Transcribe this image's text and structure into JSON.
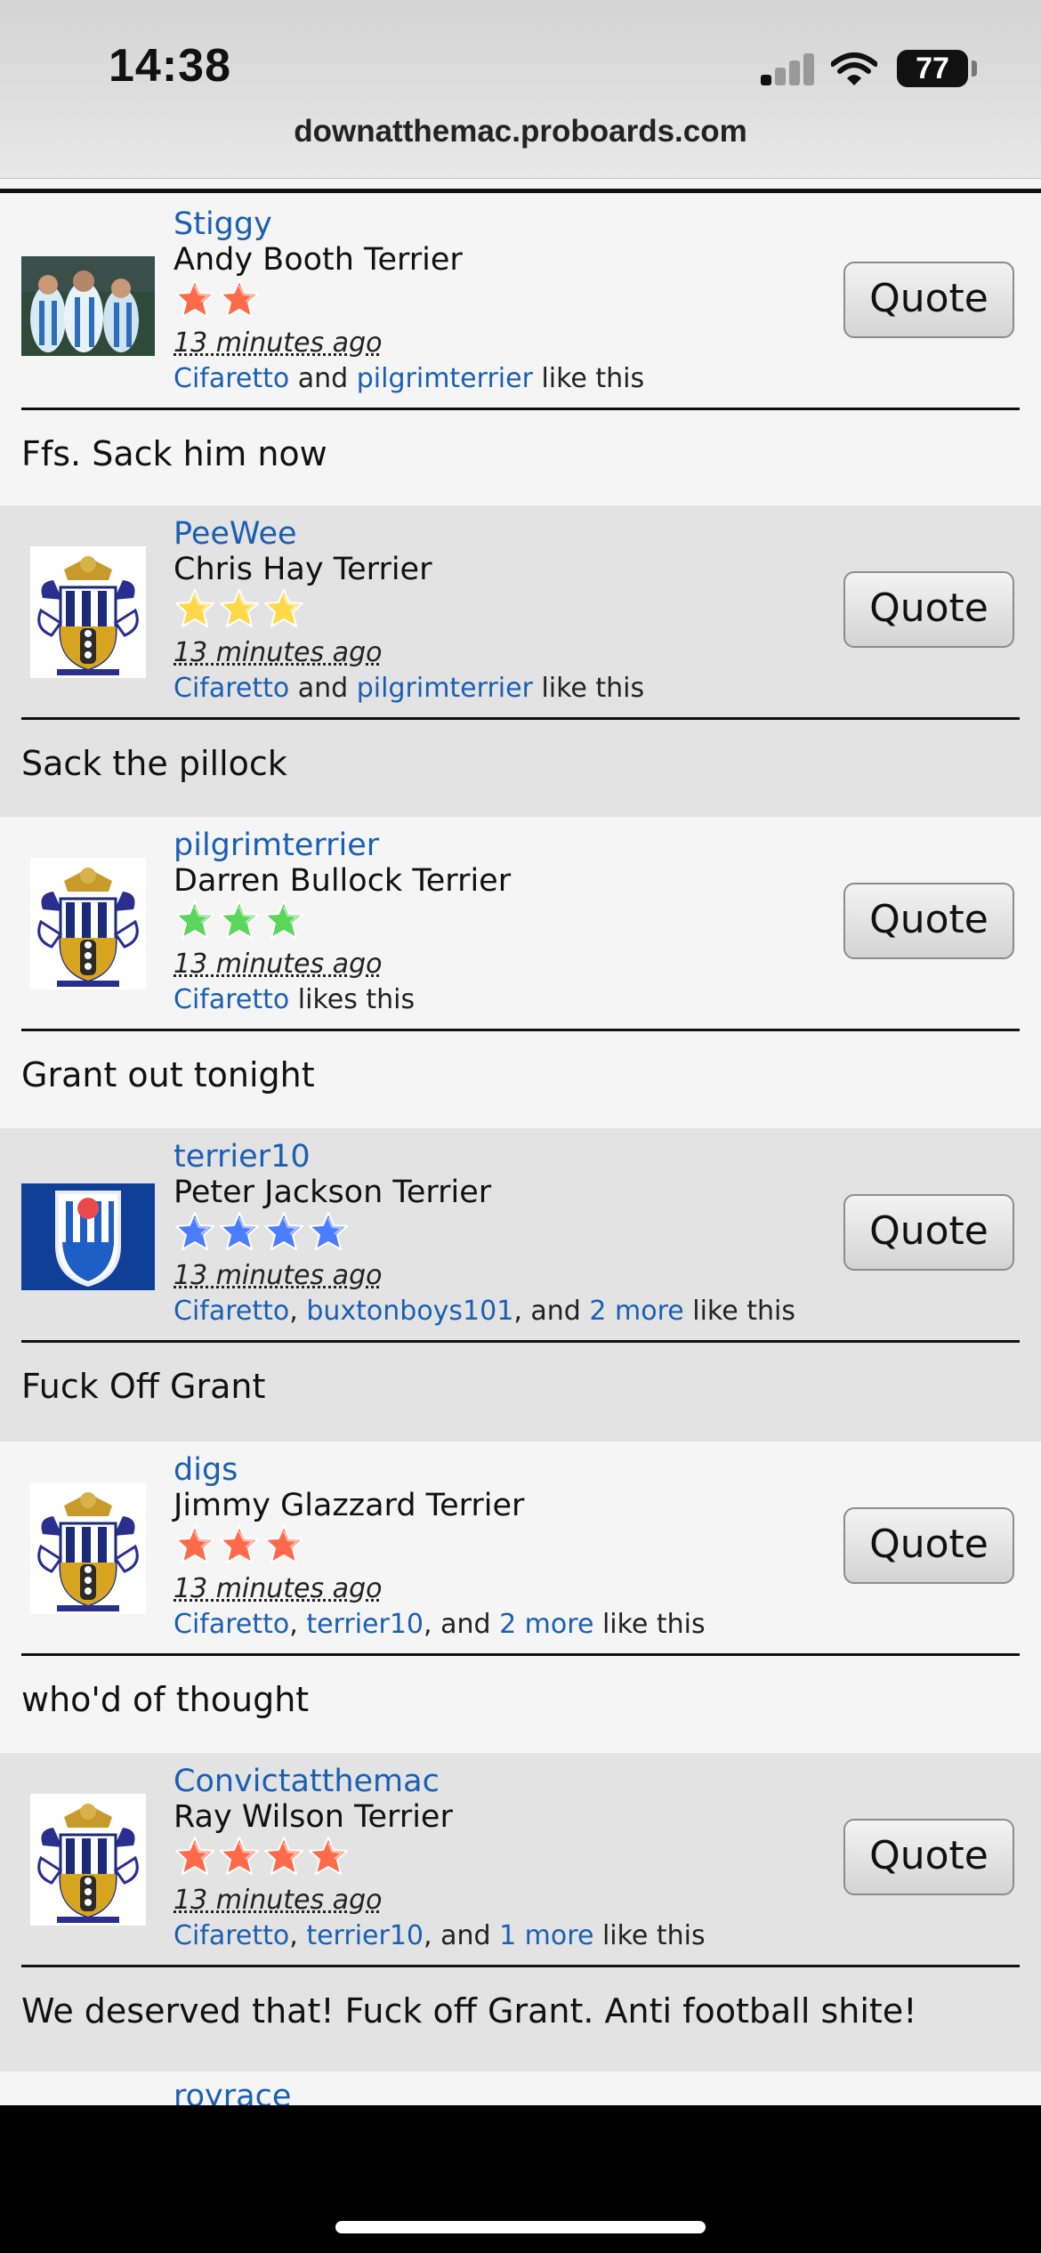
{
  "status": {
    "time": "14:38",
    "battery": "77"
  },
  "browser": {
    "url": "downatthemac.proboards.com"
  },
  "posts": [
    {
      "username": "Stiggy",
      "rank": "Andy Booth Terrier",
      "stars": 2,
      "star_color": "#ff6b4a",
      "time_ago": "13 minutes ago",
      "likes": {
        "user1": "Cifaretto",
        "sep1": " and ",
        "user2": "pilgrimterrier",
        "more": "",
        "suffix": " like this"
      },
      "quote_label": "Quote",
      "message": "Ffs. Sack him now"
    },
    {
      "username": "PeeWee",
      "rank": "Chris Hay Terrier",
      "stars": 3,
      "star_color": "#ffd84a",
      "time_ago": "13 minutes ago",
      "likes": {
        "user1": "Cifaretto",
        "sep1": " and ",
        "user2": "pilgrimterrier",
        "more": "",
        "suffix": " like this"
      },
      "quote_label": "Quote",
      "message": "Sack the pillock"
    },
    {
      "username": "pilgrimterrier",
      "rank": "Darren Bullock Terrier",
      "stars": 3,
      "star_color": "#5ad65a",
      "time_ago": "13 minutes ago",
      "likes": {
        "user1": "Cifaretto",
        "sep1": "",
        "user2": "",
        "more": "",
        "suffix": " likes this"
      },
      "quote_label": "Quote",
      "message": "Grant out tonight"
    },
    {
      "username": "terrier10",
      "rank": "Peter Jackson Terrier",
      "stars": 4,
      "star_color": "#4a7dff",
      "time_ago": "13 minutes ago",
      "likes": {
        "user1": "Cifaretto",
        "sep1": ", ",
        "user2": "buxtonboys101",
        "sep2": ", and ",
        "more": "2 more",
        "suffix": " like this"
      },
      "quote_label": "Quote",
      "message": "Fuck Off Grant"
    },
    {
      "username": "digs",
      "rank": "Jimmy Glazzard Terrier",
      "stars": 3,
      "star_color": "#ff6b4a",
      "time_ago": "13 minutes ago",
      "likes": {
        "user1": "Cifaretto",
        "sep1": ", ",
        "user2": "terrier10",
        "sep2": ", and ",
        "more": "2 more",
        "suffix": " like this"
      },
      "quote_label": "Quote",
      "message": "who'd of thought"
    },
    {
      "username": "Convictatthemac",
      "rank": "Ray Wilson Terrier",
      "stars": 4,
      "star_color": "#ff6b4a",
      "time_ago": "13 minutes ago",
      "likes": {
        "user1": "Cifaretto",
        "sep1": ", ",
        "user2": "terrier10",
        "sep2": ", and ",
        "more": "1 more",
        "suffix": " like this"
      },
      "quote_label": "Quote",
      "message": "We deserved that! Fuck off Grant. Anti football shite!"
    }
  ],
  "next_post_username": "royrace",
  "avatars": [
    "team-photo",
    "club-crest",
    "club-crest",
    "crest-blue-badge",
    "club-crest",
    "club-crest"
  ]
}
